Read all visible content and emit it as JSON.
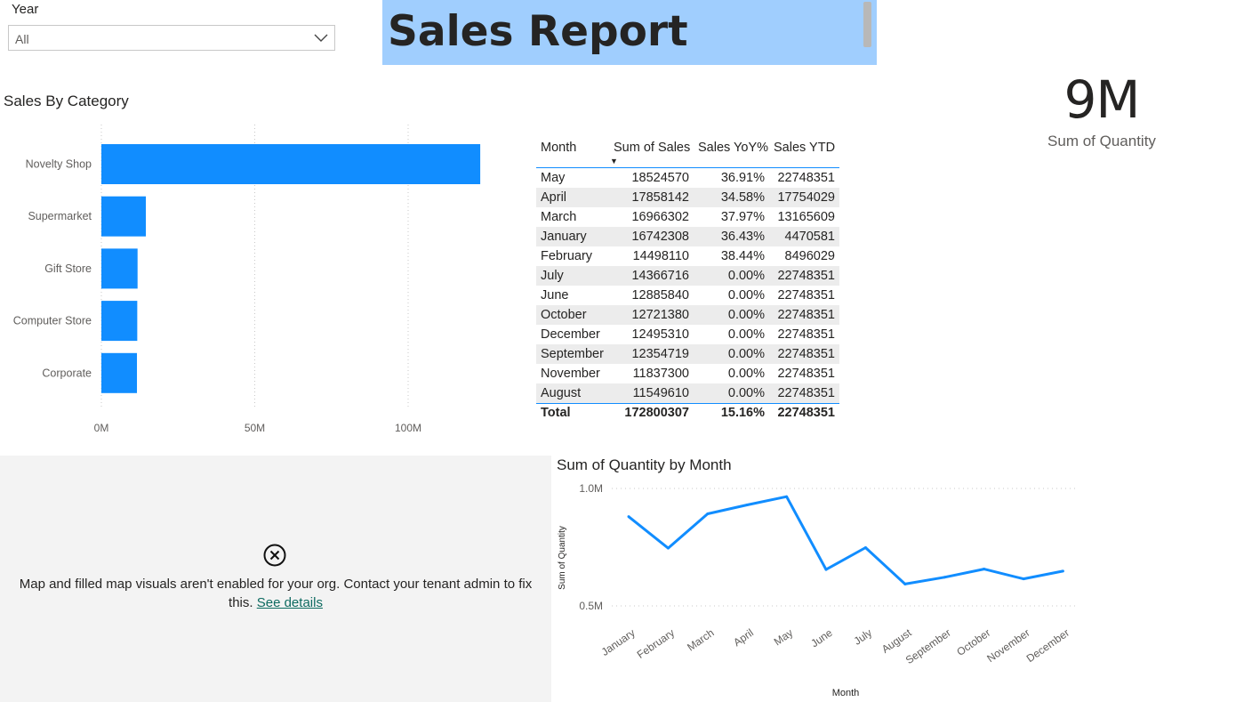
{
  "slicer": {
    "title": "Year",
    "value": "All"
  },
  "header": {
    "title": "Sales Report"
  },
  "card": {
    "value": "9M",
    "label": "Sum of Quantity"
  },
  "bar_chart_title": "Sales By Category",
  "table": {
    "columns": [
      "Month",
      "Sum of Sales",
      "Sales YoY%",
      "Sales YTD"
    ],
    "rows": [
      [
        "May",
        "18524570",
        "36.91%",
        "22748351"
      ],
      [
        "April",
        "17858142",
        "34.58%",
        "17754029"
      ],
      [
        "March",
        "16966302",
        "37.97%",
        "13165609"
      ],
      [
        "January",
        "16742308",
        "36.43%",
        "4470581"
      ],
      [
        "February",
        "14498110",
        "38.44%",
        "8496029"
      ],
      [
        "July",
        "14366716",
        "0.00%",
        "22748351"
      ],
      [
        "June",
        "12885840",
        "0.00%",
        "22748351"
      ],
      [
        "October",
        "12721380",
        "0.00%",
        "22748351"
      ],
      [
        "December",
        "12495310",
        "0.00%",
        "22748351"
      ],
      [
        "September",
        "12354719",
        "0.00%",
        "22748351"
      ],
      [
        "November",
        "11837300",
        "0.00%",
        "22748351"
      ],
      [
        "August",
        "11549610",
        "0.00%",
        "22748351"
      ]
    ],
    "total": [
      "Total",
      "172800307",
      "15.16%",
      "22748351"
    ]
  },
  "map_error": {
    "message": "Map and filled map visuals aren't enabled for your org. Contact your tenant admin to fix this.",
    "link": "See details"
  },
  "line_chart_title": "Sum of Quantity by Month",
  "colors": {
    "accent": "#118dff",
    "banner": "#a0cefe",
    "link": "#0e6b61"
  },
  "chart_data": [
    {
      "type": "bar",
      "orientation": "horizontal",
      "title": "Sales By Category",
      "categories": [
        "Novelty Shop",
        "Supermarket",
        "Gift Store",
        "Computer Store",
        "Corporate"
      ],
      "values": [
        123500000,
        14500000,
        11800000,
        11700000,
        11600000
      ],
      "xticks": [
        "0M",
        "50M",
        "100M"
      ],
      "xlim": [
        0,
        120000000
      ],
      "grid": true
    },
    {
      "type": "line",
      "title": "Sum of Quantity by Month",
      "xlabel": "Month",
      "ylabel": "Sum of Quantity",
      "x": [
        "January",
        "February",
        "March",
        "April",
        "May",
        "June",
        "July",
        "August",
        "September",
        "October",
        "November",
        "December"
      ],
      "values": [
        880000,
        746000,
        892000,
        930000,
        965000,
        655000,
        748000,
        593000,
        622000,
        657000,
        615000,
        648000
      ],
      "yticks": [
        "1.0M",
        "0.5M"
      ],
      "ylim": [
        500000,
        1000000
      ],
      "grid": true
    }
  ]
}
